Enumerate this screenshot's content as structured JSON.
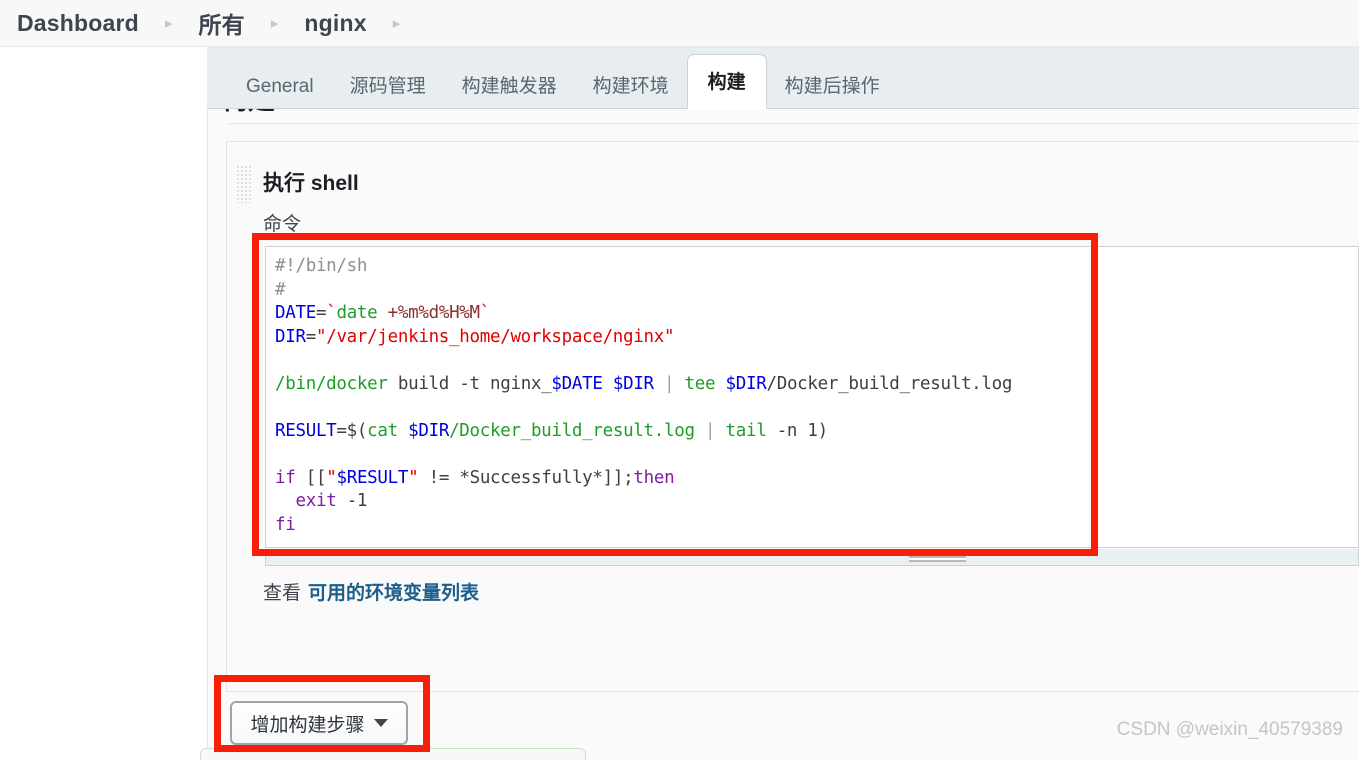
{
  "breadcrumb": {
    "items": [
      {
        "label": "Dashboard"
      },
      {
        "label": "所有"
      },
      {
        "label": "nginx"
      }
    ],
    "separator": "▸"
  },
  "tabs": [
    {
      "label": "General",
      "active": false
    },
    {
      "label": "源码管理",
      "active": false
    },
    {
      "label": "构建触发器",
      "active": false
    },
    {
      "label": "构建环境",
      "active": false
    },
    {
      "label": "构建",
      "active": true
    },
    {
      "label": "构建后操作",
      "active": false
    }
  ],
  "section": {
    "heading": "构建"
  },
  "build_step": {
    "drag_handle_icon": "drag-grid-icon",
    "title": "执行 shell",
    "command_label": "命令",
    "command_value": "#!/bin/sh\n#\nDATE=`date +%m%d%H%M`\nDIR=\"/var/jenkins_home/workspace/nginx\"\n\n/bin/docker build -t nginx_$DATE $DIR | tee $DIR/Docker_build_result.log\n\nRESULT=$(cat $DIR/Docker_build_result.log | tail -n 1)\n\nif [[\"$RESULT\" != *Successfully*]];then\n  exit -1\nfi",
    "env_text": "查看",
    "env_link_label": "可用的环境变量列表"
  },
  "buttons": {
    "add_build_step": "增加构建步骤",
    "add_build_step_caret": "chevron-down-icon"
  },
  "annotations": [
    {
      "name": "command-textarea-highlight",
      "color": "#f91e08"
    },
    {
      "name": "add-build-step-highlight",
      "color": "#f91e08"
    }
  ],
  "watermark": "CSDN @weixin_40579389",
  "colors": {
    "accent_link": "#1b5e8c",
    "annotation_red": "#f91e08",
    "tab_bar_bg": "#e8edf0",
    "panel_bg": "#fafafa"
  }
}
